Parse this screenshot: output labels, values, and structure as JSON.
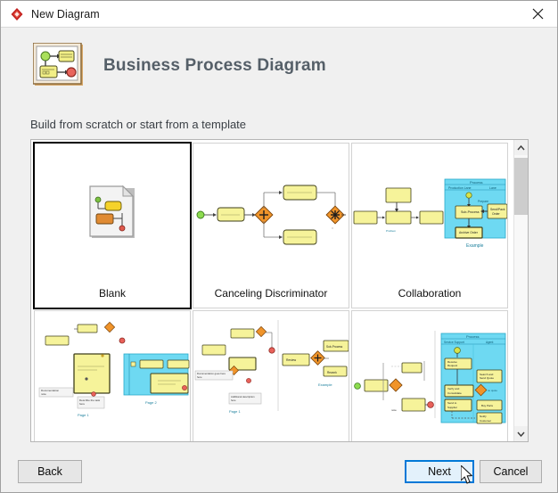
{
  "window": {
    "title": "New Diagram",
    "app_icon": "red-diamond-logo-icon",
    "close_label": "close-icon"
  },
  "header": {
    "icon": "bpmn-diagram-icon",
    "title": "Business Process Diagram"
  },
  "subtitle": "Build from scratch or start from a template",
  "templates": {
    "scrollbar": {
      "up_arrow": "chevron-up-icon",
      "down_arrow": "chevron-down-icon"
    },
    "items": [
      {
        "label": "Blank",
        "selected": true,
        "thumb": "blank-document"
      },
      {
        "label": "Canceling Discriminator",
        "selected": false,
        "thumb": "canceling-discriminator"
      },
      {
        "label": "Collaboration",
        "selected": false,
        "thumb": "collaboration"
      },
      {
        "label": "",
        "selected": false,
        "thumb": "row2-a"
      },
      {
        "label": "",
        "selected": false,
        "thumb": "row2-b"
      },
      {
        "label": "",
        "selected": false,
        "thumb": "row2-c"
      }
    ]
  },
  "footer": {
    "back_label": "Back",
    "next_label": "Next",
    "cancel_label": "Cancel"
  },
  "colors": {
    "accent_blue": "#0078d7",
    "hover_fill": "#e3f1fb",
    "pool_cyan": "#6ed9f2",
    "task_yellow": "#f6f39a",
    "gateway_orange": "#f0942a",
    "start_green": "#8ddc4f",
    "end_red": "#e8615a",
    "title_gray": "#555f68",
    "window_bg": "#f0f0f0"
  }
}
